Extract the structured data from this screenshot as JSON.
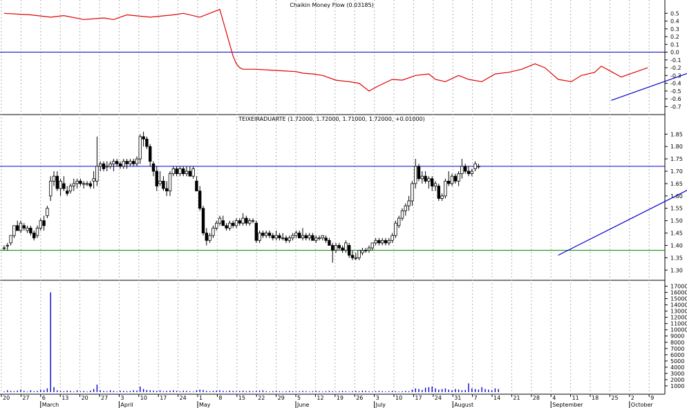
{
  "colors": {
    "cmf_line": "#e00000",
    "trendline": "#0000cc",
    "resistance": "#0000cc",
    "support": "#008000",
    "volume": "#0000cc",
    "grid": "#b0b0b0",
    "candle": "#000000"
  },
  "chart_data": [
    {
      "type": "line",
      "title": "Chaikin Money Flow (0.03185)",
      "ylim": [
        -0.75,
        0.6
      ],
      "y_ticks": [
        0.5,
        0.4,
        0.3,
        0.2,
        0.1,
        0.0,
        -0.1,
        -0.2,
        -0.3,
        -0.4,
        -0.5,
        -0.6,
        -0.7
      ],
      "reference_line": 0.0,
      "series": [
        {
          "x": [
            0,
            8,
            14,
            18,
            24,
            30,
            33,
            37,
            44,
            51,
            54,
            59,
            65,
            66,
            67,
            68,
            69,
            70,
            71,
            72,
            76,
            80,
            84,
            88,
            90,
            93,
            96,
            100,
            104,
            107,
            110,
            113,
            117,
            120,
            124,
            128,
            130,
            133,
            137,
            140,
            144,
            148,
            152,
            156,
            160,
            163,
            167,
            171,
            174,
            178,
            180,
            183,
            186,
            190,
            194
          ],
          "values": [
            0.5,
            0.48,
            0.45,
            0.47,
            0.42,
            0.44,
            0.42,
            0.48,
            0.45,
            0.48,
            0.5,
            0.45,
            0.55,
            0.4,
            0.25,
            0.1,
            -0.05,
            -0.15,
            -0.2,
            -0.22,
            -0.22,
            -0.23,
            -0.24,
            -0.25,
            -0.27,
            -0.28,
            -0.3,
            -0.36,
            -0.38,
            -0.4,
            -0.5,
            -0.43,
            -0.35,
            -0.36,
            -0.3,
            -0.28,
            -0.35,
            -0.38,
            -0.3,
            -0.35,
            -0.38,
            -0.28,
            -0.26,
            -0.22,
            -0.15,
            -0.2,
            -0.35,
            -0.38,
            -0.3,
            -0.26,
            -0.18,
            -0.25,
            -0.32,
            -0.26,
            -0.2
          ]
        }
      ],
      "trendline": {
        "from": [
          183,
          -0.62
        ],
        "to": [
          226,
          0.03
        ]
      }
    },
    {
      "type": "candlestick",
      "title": "TEIXEIRADUARTE (1.72000, 1.72000, 1.71000, 1.72000, +0.01000)",
      "ylim": [
        1.27,
        1.89
      ],
      "y_ticks": [
        1.85,
        1.8,
        1.75,
        1.7,
        1.65,
        1.6,
        1.55,
        1.5,
        1.45,
        1.4,
        1.35,
        1.3
      ],
      "resistance_level": 1.72,
      "support_level": 1.38,
      "trendlines": [
        {
          "from": [
            167,
            1.36
          ],
          "to": [
            232,
            1.8
          ]
        }
      ],
      "candles": [
        [
          1.39,
          1.4,
          1.38,
          1.39
        ],
        [
          1.4,
          1.41,
          1.38,
          1.4
        ],
        [
          1.41,
          1.44,
          1.4,
          1.44
        ],
        [
          1.44,
          1.48,
          1.43,
          1.48
        ],
        [
          1.48,
          1.5,
          1.46,
          1.46
        ],
        [
          1.46,
          1.5,
          1.45,
          1.49
        ],
        [
          1.48,
          1.49,
          1.46,
          1.47
        ],
        [
          1.46,
          1.48,
          1.45,
          1.47
        ],
        [
          1.47,
          1.48,
          1.44,
          1.45
        ],
        [
          1.45,
          1.46,
          1.42,
          1.43
        ],
        [
          1.44,
          1.48,
          1.43,
          1.47
        ],
        [
          1.47,
          1.51,
          1.46,
          1.5
        ],
        [
          1.5,
          1.52,
          1.46,
          1.48
        ],
        [
          1.52,
          1.56,
          1.51,
          1.55
        ],
        [
          1.6,
          1.68,
          1.58,
          1.66
        ],
        [
          1.66,
          1.7,
          1.64,
          1.68
        ],
        [
          1.68,
          1.7,
          1.62,
          1.63
        ],
        [
          1.63,
          1.67,
          1.6,
          1.66
        ],
        [
          1.65,
          1.68,
          1.62,
          1.63
        ],
        [
          1.62,
          1.64,
          1.6,
          1.61
        ],
        [
          1.62,
          1.65,
          1.61,
          1.64
        ],
        [
          1.64,
          1.67,
          1.62,
          1.65
        ],
        [
          1.65,
          1.67,
          1.63,
          1.66
        ],
        [
          1.66,
          1.67,
          1.64,
          1.65
        ],
        [
          1.65,
          1.66,
          1.63,
          1.65
        ],
        [
          1.65,
          1.66,
          1.64,
          1.65
        ],
        [
          1.65,
          1.66,
          1.63,
          1.64
        ],
        [
          1.66,
          1.7,
          1.63,
          1.67
        ],
        [
          1.66,
          1.84,
          1.64,
          1.72
        ],
        [
          1.72,
          1.74,
          1.7,
          1.73
        ],
        [
          1.73,
          1.74,
          1.7,
          1.71
        ],
        [
          1.72,
          1.74,
          1.7,
          1.72
        ],
        [
          1.72,
          1.74,
          1.71,
          1.73
        ],
        [
          1.73,
          1.75,
          1.7,
          1.74
        ],
        [
          1.74,
          1.75,
          1.72,
          1.73
        ],
        [
          1.73,
          1.74,
          1.71,
          1.72
        ],
        [
          1.72,
          1.75,
          1.71,
          1.74
        ],
        [
          1.74,
          1.75,
          1.71,
          1.73
        ],
        [
          1.73,
          1.75,
          1.72,
          1.74
        ],
        [
          1.74,
          1.75,
          1.72,
          1.73
        ],
        [
          1.73,
          1.76,
          1.72,
          1.75
        ],
        [
          1.75,
          1.85,
          1.73,
          1.84
        ],
        [
          1.84,
          1.86,
          1.8,
          1.83
        ],
        [
          1.83,
          1.84,
          1.79,
          1.8
        ],
        [
          1.8,
          1.81,
          1.72,
          1.74
        ],
        [
          1.73,
          1.74,
          1.68,
          1.7
        ],
        [
          1.7,
          1.72,
          1.62,
          1.64
        ],
        [
          1.65,
          1.7,
          1.64,
          1.66
        ],
        [
          1.66,
          1.68,
          1.62,
          1.63
        ],
        [
          1.63,
          1.66,
          1.6,
          1.62
        ],
        [
          1.62,
          1.7,
          1.6,
          1.69
        ],
        [
          1.69,
          1.72,
          1.68,
          1.71
        ],
        [
          1.71,
          1.72,
          1.68,
          1.69
        ],
        [
          1.69,
          1.72,
          1.68,
          1.71
        ],
        [
          1.71,
          1.72,
          1.68,
          1.69
        ],
        [
          1.69,
          1.72,
          1.68,
          1.7
        ],
        [
          1.7,
          1.72,
          1.68,
          1.68
        ],
        [
          1.68,
          1.72,
          1.67,
          1.71
        ],
        [
          1.66,
          1.68,
          1.62,
          1.62
        ],
        [
          1.62,
          1.64,
          1.54,
          1.55
        ],
        [
          1.55,
          1.56,
          1.44,
          1.45
        ],
        [
          1.45,
          1.47,
          1.4,
          1.42
        ],
        [
          1.42,
          1.45,
          1.41,
          1.44
        ],
        [
          1.44,
          1.48,
          1.43,
          1.47
        ],
        [
          1.47,
          1.5,
          1.46,
          1.49
        ],
        [
          1.49,
          1.52,
          1.48,
          1.51
        ],
        [
          1.5,
          1.52,
          1.48,
          1.48
        ],
        [
          1.48,
          1.49,
          1.46,
          1.47
        ],
        [
          1.47,
          1.5,
          1.46,
          1.49
        ],
        [
          1.49,
          1.5,
          1.47,
          1.48
        ],
        [
          1.48,
          1.51,
          1.47,
          1.5
        ],
        [
          1.5,
          1.51,
          1.48,
          1.49
        ],
        [
          1.49,
          1.53,
          1.48,
          1.51
        ],
        [
          1.51,
          1.52,
          1.48,
          1.49
        ],
        [
          1.49,
          1.51,
          1.48,
          1.5
        ],
        [
          1.5,
          1.51,
          1.49,
          1.5
        ],
        [
          1.49,
          1.5,
          1.41,
          1.42
        ],
        [
          1.42,
          1.46,
          1.41,
          1.45
        ],
        [
          1.45,
          1.46,
          1.43,
          1.44
        ],
        [
          1.44,
          1.46,
          1.43,
          1.45
        ],
        [
          1.45,
          1.46,
          1.43,
          1.44
        ],
        [
          1.44,
          1.45,
          1.42,
          1.43
        ],
        [
          1.43,
          1.46,
          1.42,
          1.44
        ],
        [
          1.44,
          1.45,
          1.42,
          1.43
        ],
        [
          1.43,
          1.45,
          1.42,
          1.43
        ],
        [
          1.43,
          1.44,
          1.41,
          1.42
        ],
        [
          1.42,
          1.44,
          1.41,
          1.43
        ],
        [
          1.43,
          1.45,
          1.42,
          1.44
        ],
        [
          1.44,
          1.46,
          1.43,
          1.45
        ],
        [
          1.45,
          1.46,
          1.43,
          1.43
        ],
        [
          1.43,
          1.47,
          1.42,
          1.44
        ],
        [
          1.44,
          1.45,
          1.42,
          1.43
        ],
        [
          1.43,
          1.45,
          1.42,
          1.44
        ],
        [
          1.44,
          1.45,
          1.42,
          1.42
        ],
        [
          1.42,
          1.44,
          1.41,
          1.43
        ],
        [
          1.43,
          1.44,
          1.42,
          1.43
        ],
        [
          1.43,
          1.44,
          1.42,
          1.44
        ],
        [
          1.43,
          1.44,
          1.41,
          1.42
        ],
        [
          1.42,
          1.43,
          1.4,
          1.4
        ],
        [
          1.4,
          1.41,
          1.33,
          1.38
        ],
        [
          1.38,
          1.41,
          1.37,
          1.4
        ],
        [
          1.4,
          1.41,
          1.38,
          1.39
        ],
        [
          1.39,
          1.4,
          1.37,
          1.38
        ],
        [
          1.38,
          1.42,
          1.37,
          1.41
        ],
        [
          1.4,
          1.41,
          1.35,
          1.36
        ],
        [
          1.36,
          1.38,
          1.34,
          1.35
        ],
        [
          1.35,
          1.37,
          1.34,
          1.35
        ],
        [
          1.35,
          1.38,
          1.34,
          1.38
        ],
        [
          1.37,
          1.39,
          1.36,
          1.38
        ],
        [
          1.38,
          1.39,
          1.37,
          1.38
        ],
        [
          1.38,
          1.4,
          1.37,
          1.39
        ],
        [
          1.39,
          1.41,
          1.38,
          1.41
        ],
        [
          1.41,
          1.43,
          1.4,
          1.42
        ],
        [
          1.42,
          1.43,
          1.4,
          1.41
        ],
        [
          1.41,
          1.43,
          1.4,
          1.42
        ],
        [
          1.42,
          1.43,
          1.4,
          1.41
        ],
        [
          1.41,
          1.43,
          1.4,
          1.42
        ],
        [
          1.42,
          1.45,
          1.41,
          1.44
        ],
        [
          1.44,
          1.5,
          1.43,
          1.49
        ],
        [
          1.48,
          1.52,
          1.47,
          1.51
        ],
        [
          1.51,
          1.55,
          1.5,
          1.54
        ],
        [
          1.54,
          1.57,
          1.52,
          1.56
        ],
        [
          1.56,
          1.6,
          1.54,
          1.58
        ],
        [
          1.58,
          1.66,
          1.56,
          1.65
        ],
        [
          1.65,
          1.75,
          1.63,
          1.72
        ],
        [
          1.72,
          1.73,
          1.66,
          1.67
        ],
        [
          1.67,
          1.7,
          1.65,
          1.68
        ],
        [
          1.68,
          1.7,
          1.65,
          1.66
        ],
        [
          1.66,
          1.68,
          1.63,
          1.67
        ],
        [
          1.67,
          1.68,
          1.62,
          1.64
        ],
        [
          1.64,
          1.66,
          1.62,
          1.65
        ],
        [
          1.64,
          1.65,
          1.58,
          1.59
        ],
        [
          1.59,
          1.61,
          1.58,
          1.6
        ],
        [
          1.6,
          1.67,
          1.59,
          1.66
        ],
        [
          1.66,
          1.7,
          1.64,
          1.65
        ],
        [
          1.65,
          1.69,
          1.64,
          1.68
        ],
        [
          1.68,
          1.69,
          1.65,
          1.66
        ],
        [
          1.66,
          1.7,
          1.64,
          1.69
        ],
        [
          1.69,
          1.75,
          1.67,
          1.72
        ],
        [
          1.72,
          1.73,
          1.69,
          1.7
        ],
        [
          1.7,
          1.72,
          1.68,
          1.69
        ],
        [
          1.69,
          1.71,
          1.68,
          1.7
        ],
        [
          1.71,
          1.74,
          1.7,
          1.73
        ],
        [
          1.72,
          1.73,
          1.71,
          1.72
        ]
      ]
    },
    {
      "type": "bar",
      "title": "",
      "ylim": [
        0,
        17500
      ],
      "y_ticks": [
        17000,
        16000,
        15000,
        14000,
        13000,
        12000,
        11000,
        10000,
        9000,
        8000,
        7000,
        6000,
        5000,
        4000,
        3000,
        2000,
        1000
      ],
      "y_tick_labels": [
        "17000",
        "16000",
        "15000",
        "14000",
        "13000",
        "12000",
        "11000",
        "10000",
        "9000",
        "8000",
        "7000",
        "6000",
        "5000",
        "4000",
        "3000",
        "2000",
        "1000"
      ],
      "values": [
        100,
        300,
        200,
        150,
        250,
        400,
        200,
        100,
        300,
        150,
        200,
        400,
        300,
        600,
        16000,
        800,
        300,
        200,
        150,
        250,
        200,
        100,
        300,
        150,
        200,
        100,
        250,
        500,
        1200,
        300,
        200,
        150,
        300,
        200,
        100,
        250,
        200,
        150,
        200,
        300,
        250,
        900,
        500,
        350,
        300,
        250,
        200,
        300,
        150,
        200,
        250,
        300,
        200,
        150,
        250,
        200,
        150,
        100,
        300,
        400,
        350,
        200,
        150,
        200,
        250,
        300,
        200,
        150,
        250,
        200,
        150,
        200,
        250,
        150,
        200,
        150,
        200,
        250,
        300,
        150,
        100,
        150,
        200,
        150,
        100,
        150,
        200,
        150,
        100,
        150,
        200,
        150,
        100,
        150,
        200,
        150,
        100,
        150,
        200,
        150,
        100,
        150,
        200,
        150,
        100,
        150,
        200,
        150,
        250,
        200,
        150,
        100,
        150,
        200,
        150,
        100,
        150,
        200,
        150,
        100,
        150,
        200,
        150,
        400,
        600,
        500,
        350,
        700,
        800,
        900,
        600,
        400,
        500,
        600,
        400,
        300,
        500,
        400,
        300,
        350,
        1400,
        600,
        500,
        400,
        800,
        500,
        400,
        300,
        600,
        500
      ]
    }
  ],
  "x_axis": {
    "day_labels": [
      "20",
      "27",
      "6",
      "13",
      "20",
      "27",
      "3",
      "10",
      "17",
      "24",
      "1",
      "8",
      "15",
      "22",
      "29",
      "5",
      "12",
      "19",
      "26",
      "3",
      "10",
      "17",
      "24",
      "31",
      "7",
      "14",
      "21",
      "28",
      "4",
      "11",
      "18",
      "25",
      "2",
      "9"
    ],
    "month_labels": [
      "March",
      "April",
      "May",
      "June",
      "July",
      "August",
      "September",
      "October"
    ]
  }
}
